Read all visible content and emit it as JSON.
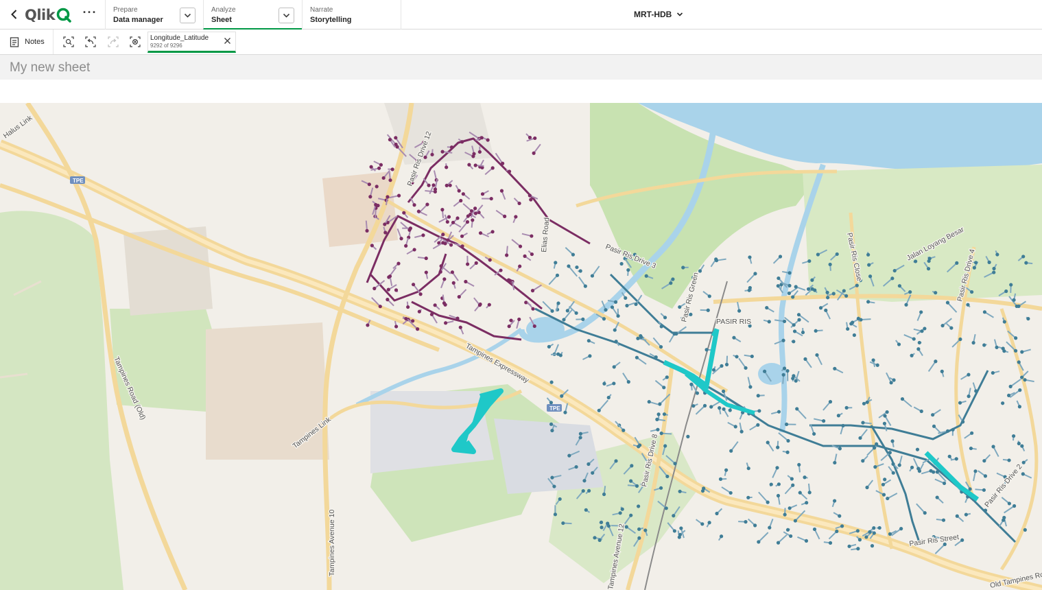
{
  "nav": {
    "logo": "Qlik",
    "more": "···",
    "prepare": {
      "sup": "Prepare",
      "main": "Data manager"
    },
    "analyze": {
      "sup": "Analyze",
      "main": "Sheet"
    },
    "narrate": {
      "sup": "Narrate",
      "main": "Storytelling"
    },
    "app_title": "MRT-HDB"
  },
  "toolbar": {
    "notes_label": "Notes",
    "selection": {
      "field": "Longitude_Latitude",
      "count": "9292 of 9296"
    }
  },
  "sheet": {
    "title": "My new sheet"
  },
  "map": {
    "labels": {
      "halus_link": "Halus Link",
      "tpe": "TPE",
      "tampines_road_old": "Tampines Road (Old)",
      "tampines_link": "Tampines Link",
      "tampines_avenue_10": "Tampines Avenue 10",
      "tampines_avenue_12": "Tampines Avenue 12",
      "tampines_expressway": "Tampines Expressway",
      "pasir_ris_drive_12": "Pasir Ris Drive 12",
      "elias_road": "Elias Road",
      "pasir_ris_drive_3": "Pasir Ris Drive 3",
      "pasir_ris_green": "Pasir Ris Green",
      "pasir_ris": "PASIR RIS",
      "pasir_ris_drive_8": "Pasir Ris Drive 8",
      "pasir_ris_close": "Pasir Ris Close",
      "jalan_loyang_besar": "Jalan Loyang Besar",
      "pasir_ris_drive_4": "Pasir Ris Drive 4",
      "pasir_ris_street": "Pasir Ris Street",
      "pasir_ris_drive_2": "Pasir Ris Drive 2",
      "old_tampines_road": "Old Tampines Ro"
    },
    "colors": {
      "land": "#f2efe9",
      "water": "#a9d3ea",
      "park": "#c8e2b1",
      "major_road": "#f3d89a",
      "purple_cluster": "#7b2d63",
      "purple_light": "#a88bb0",
      "blue_cluster": "#3f7d96",
      "blue_light": "#7fa9bf",
      "station": "#1fc8c8"
    }
  }
}
